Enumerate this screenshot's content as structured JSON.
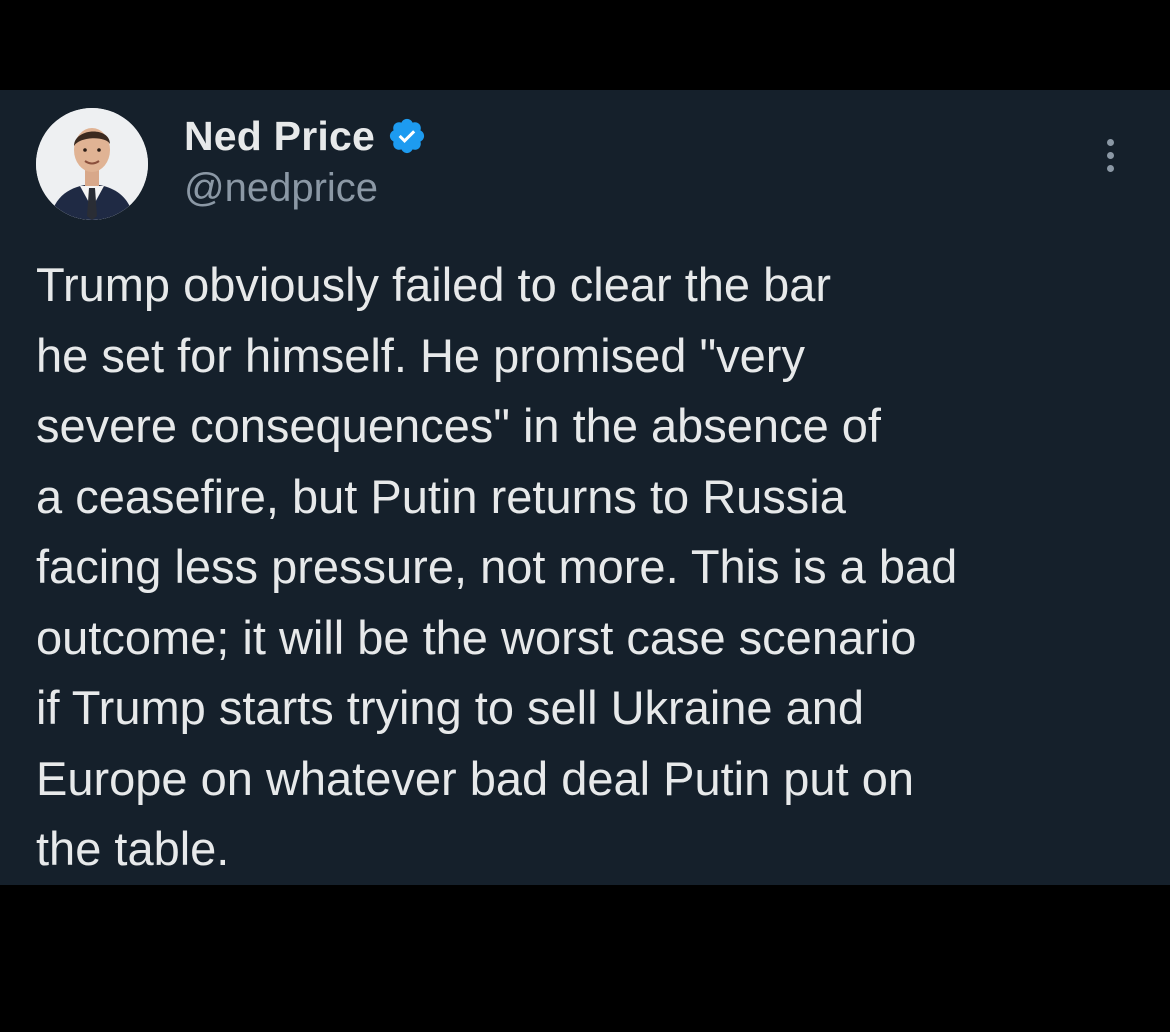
{
  "author": {
    "display_name": "Ned Price",
    "handle": "@nedprice",
    "verified": true,
    "avatar_icon": "profile-photo"
  },
  "menu": {
    "icon": "more-options-icon"
  },
  "tweet": {
    "lines": [
      "Trump obviously failed to clear the bar",
      "he set for himself. He promised \"very",
      "severe consequences\" in the absence of",
      "a ceasefire, but Putin returns to Russia",
      "facing less pressure, not more. This is a bad",
      "outcome; it will be the worst case scenario",
      "if Trump starts trying to sell Ukraine and",
      "Europe on whatever bad deal Putin put on",
      "the table."
    ]
  },
  "colors": {
    "background": "#000000",
    "card": "#15202b",
    "text_primary": "#e7e9ea",
    "text_secondary": "#8b98a5",
    "verified_blue": "#1d9bf0"
  }
}
